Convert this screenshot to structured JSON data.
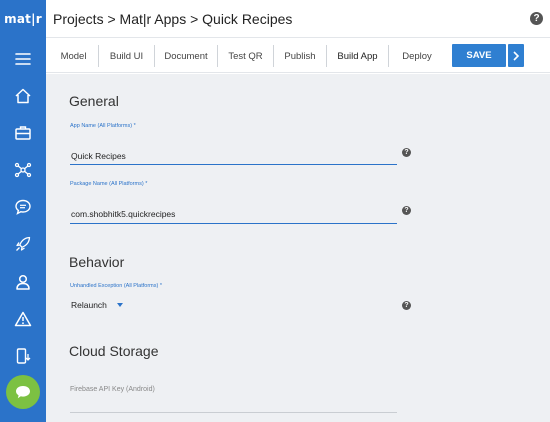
{
  "app": {
    "logo": "mat|r"
  },
  "header": {
    "breadcrumb": "Projects > Mat|r Apps > Quick Recipes",
    "help": "?"
  },
  "tabs": [
    {
      "label": "Model"
    },
    {
      "label": "Build UI"
    },
    {
      "label": "Document"
    },
    {
      "label": "Test QR"
    },
    {
      "label": "Publish"
    },
    {
      "label": "Build App"
    },
    {
      "label": "Deploy"
    }
  ],
  "toolbar": {
    "save_label": "SAVE"
  },
  "sidebar": {
    "items": [
      {
        "icon": "hamburger-menu-icon"
      },
      {
        "icon": "home-icon"
      },
      {
        "icon": "briefcase-icon"
      },
      {
        "icon": "network-icon"
      },
      {
        "icon": "comment-icon"
      },
      {
        "icon": "rocket-icon"
      },
      {
        "icon": "user-icon"
      },
      {
        "icon": "warning-icon"
      },
      {
        "icon": "mobile-download-icon"
      }
    ],
    "accent": "#2b73c9",
    "fab_color": "#7cc142"
  },
  "sections": {
    "general": {
      "title": "General",
      "app_name_label": "App Name (All Platforms) *",
      "app_name_value": "Quick Recipes",
      "package_name_label": "Package Name (All Platforms) *",
      "package_name_value": "com.shobhitk5.quickrecipes"
    },
    "behavior": {
      "title": "Behavior",
      "exception_label": "Unhandled Exception (All Platforms) *",
      "exception_value": "Relaunch"
    },
    "cloud": {
      "title": "Cloud Storage",
      "firebase_placeholder": "Firebase API Key (Android)"
    }
  }
}
